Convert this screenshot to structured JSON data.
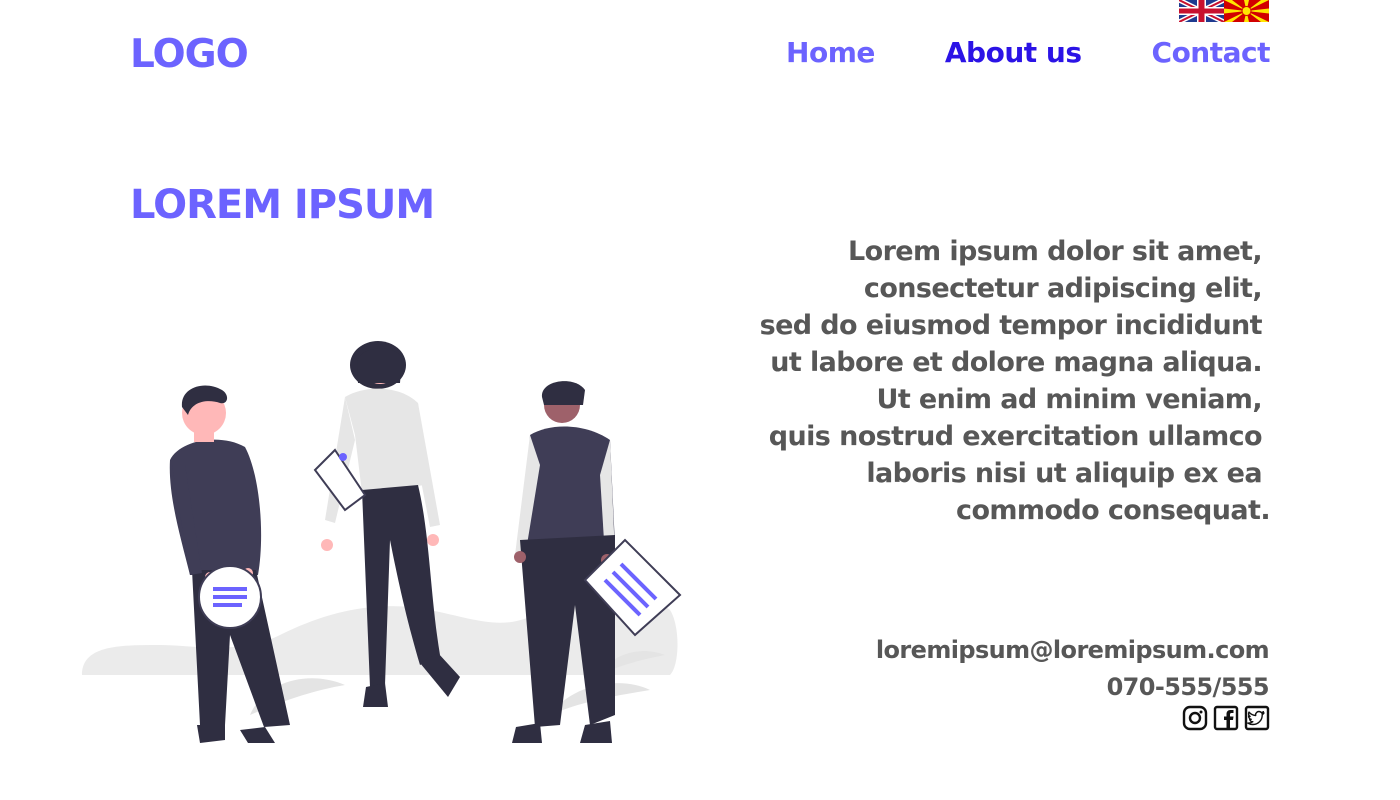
{
  "header": {
    "logo": "LOGO",
    "languages": [
      {
        "name": "en-flag-icon"
      },
      {
        "name": "mk-flag-icon"
      }
    ],
    "nav": [
      {
        "label": "Home",
        "active": false
      },
      {
        "label": "About us",
        "active": true
      },
      {
        "label": "Contact",
        "active": false
      }
    ]
  },
  "hero": {
    "title": "LOREM IPSUM",
    "description_lines": [
      "Lorem ipsum dolor sit amet,",
      "consectetur adipiscing elit,",
      "sed do eiusmod tempor incididunt",
      "ut labore et dolore magna aliqua.",
      "Ut enim ad minim veniam,",
      "quis nostrud exercitation ullamco",
      "laboris nisi ut aliquip ex ea",
      "commodo consequat."
    ]
  },
  "contact": {
    "email": "loremipsum@loremipsum.com",
    "phone": "070-555/555"
  },
  "social": [
    {
      "icon": "instagram-icon"
    },
    {
      "icon": "facebook-icon"
    },
    {
      "icon": "twitter-icon"
    }
  ],
  "colors": {
    "accent": "#6c63ff",
    "nav_active": "#2b13e6",
    "body_text": "#575757"
  }
}
